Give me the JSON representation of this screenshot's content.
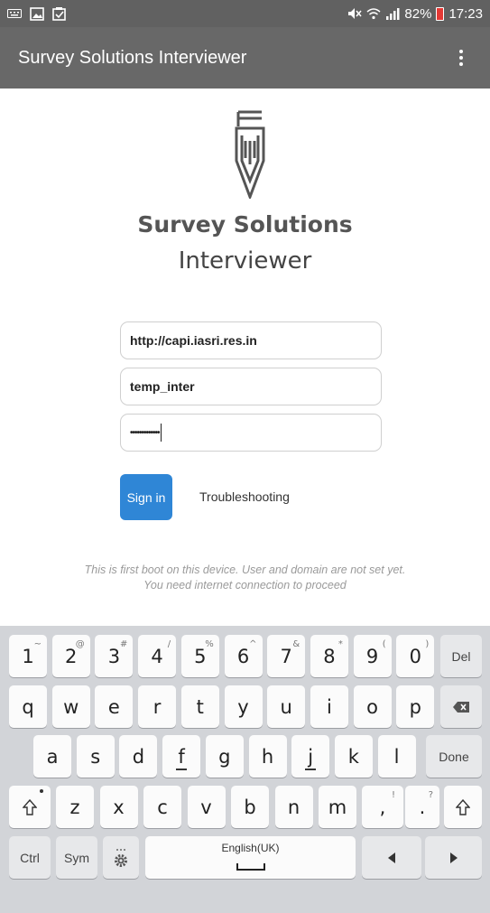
{
  "status_bar": {
    "battery": "82%",
    "time": "17:23"
  },
  "app_bar": {
    "title": "Survey Solutions Interviewer"
  },
  "brand": {
    "title": "Survey Solutions",
    "subtitle": "Interviewer"
  },
  "form": {
    "server_url": "http://capi.iasri.res.in",
    "username": "temp_inter",
    "password_mask": "•••••••••••••",
    "signin_label": "Sign in",
    "troubleshooting_label": "Troubleshooting"
  },
  "note": {
    "line1": "This is first boot on this device. User and domain are not set yet.",
    "line2": "You need internet connection to proceed"
  },
  "keyboard": {
    "number_row": [
      {
        "key": "1",
        "sup": "~"
      },
      {
        "key": "2",
        "sup": "@"
      },
      {
        "key": "3",
        "sup": "#"
      },
      {
        "key": "4",
        "sup": "/"
      },
      {
        "key": "5",
        "sup": "%"
      },
      {
        "key": "6",
        "sup": "^"
      },
      {
        "key": "7",
        "sup": "&"
      },
      {
        "key": "8",
        "sup": "*"
      },
      {
        "key": "9",
        "sup": "("
      },
      {
        "key": "0",
        "sup": ")"
      }
    ],
    "del_label": "Del",
    "row1": [
      "q",
      "w",
      "e",
      "r",
      "t",
      "y",
      "u",
      "i",
      "o",
      "p"
    ],
    "row2": [
      "a",
      "s",
      "d",
      "f",
      "g",
      "h",
      "j",
      "k",
      "l"
    ],
    "done_label": "Done",
    "row3": [
      "z",
      "x",
      "c",
      "v",
      "b",
      "n",
      "m"
    ],
    "punct1": {
      "key": ",",
      "sup": "!"
    },
    "punct2": {
      "key": ".",
      "sup": "?"
    },
    "ctrl_label": "Ctrl",
    "sym_label": "Sym",
    "space_label": "English(UK)"
  }
}
